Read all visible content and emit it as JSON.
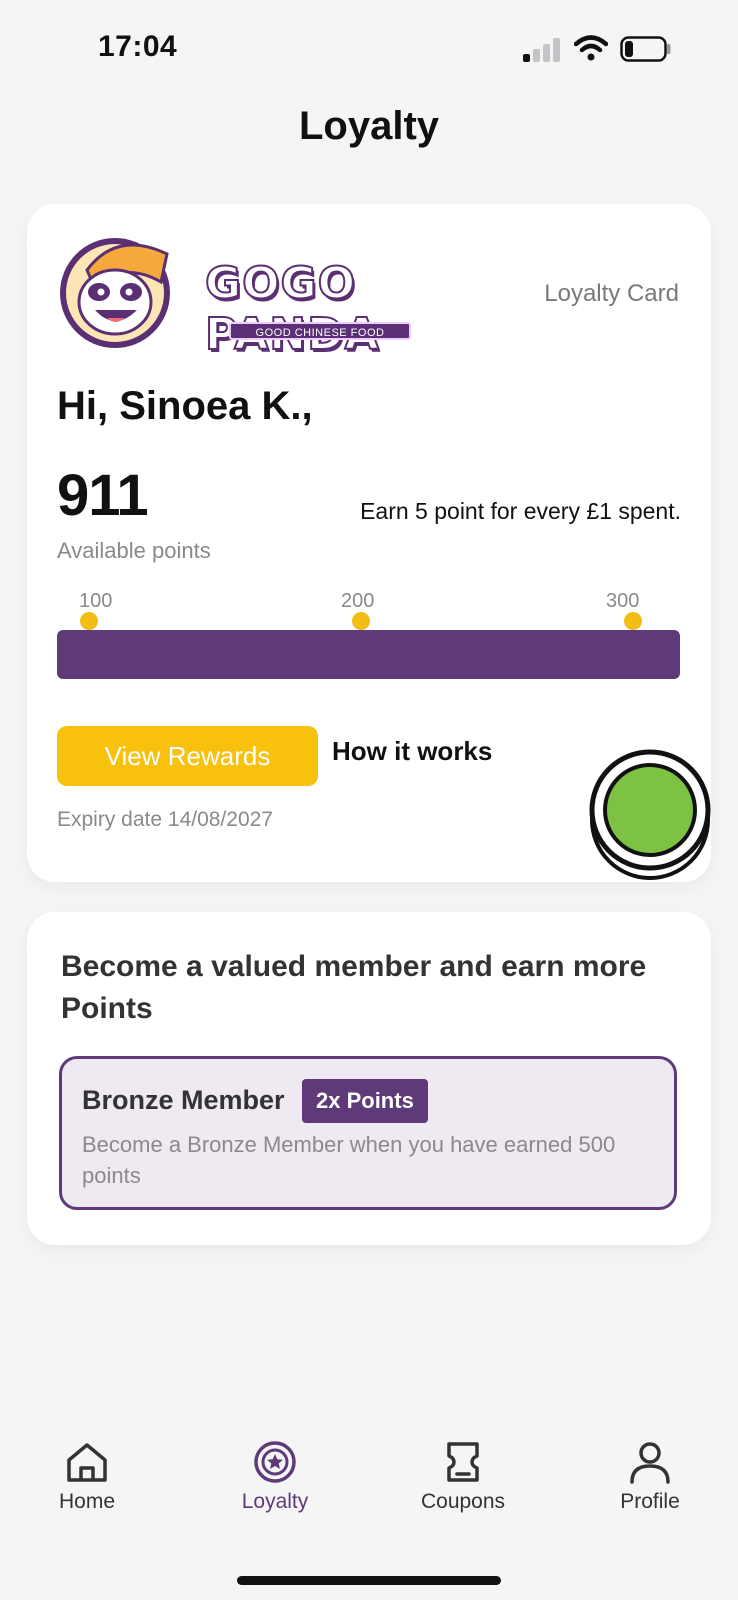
{
  "status_bar": {
    "time": "17:04"
  },
  "header": {
    "title": "Loyalty"
  },
  "loyalty_card": {
    "brand_name": "GOGO PANDA",
    "brand_tagline": "GOOD CHINESE FOOD",
    "card_type": "Loyalty Card",
    "greeting": "Hi, Sinoea K.,",
    "points": "911",
    "points_label": "Available points",
    "earn_text": "Earn 5 point for every £1 spent.",
    "milestones": [
      "100",
      "200",
      "300"
    ],
    "view_rewards_label": "View Rewards",
    "how_it_works_label": "How it works",
    "expiry": "Expiry date 14/08/2027",
    "colors": {
      "accent": "#5e3a78",
      "gold": "#f7c10d",
      "fab": "#7dc242"
    }
  },
  "membership": {
    "title": "Become a valued member and earn more Points",
    "tier": {
      "name": "Bronze Member",
      "badge": "2x Points",
      "description": "Become a Bronze Member when you have earned 500 points"
    }
  },
  "tab_bar": {
    "items": [
      {
        "label": "Home",
        "icon": "home-icon"
      },
      {
        "label": "Loyalty",
        "icon": "loyalty-icon",
        "active": true
      },
      {
        "label": "Coupons",
        "icon": "coupon-icon"
      },
      {
        "label": "Profile",
        "icon": "profile-icon"
      }
    ]
  }
}
